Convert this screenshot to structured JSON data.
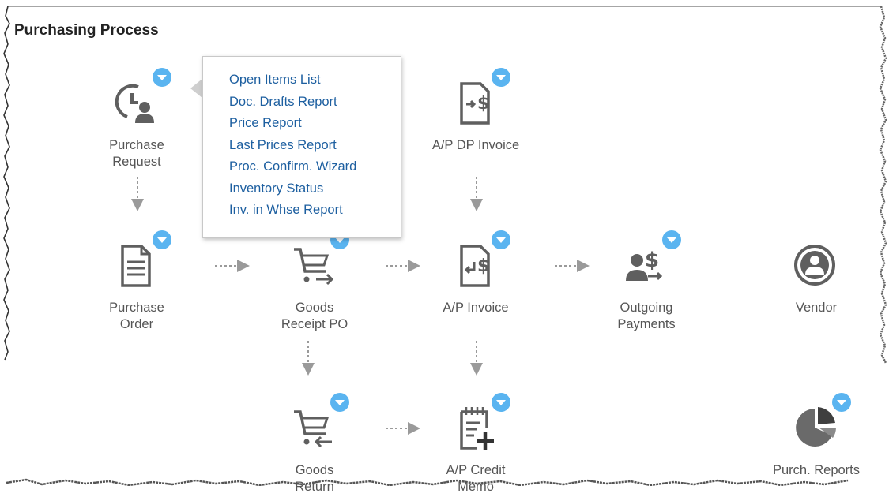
{
  "page": {
    "title": "Purchasing Process"
  },
  "colors": {
    "icon": "#5f5f5f",
    "caret": "#5ab4f0",
    "link": "#1d5fa0",
    "focus": "#e7a43a",
    "arrow": "#9a9a9a"
  },
  "nodes": {
    "purchase_request": {
      "label_line1": "Purchase",
      "label_line2": "Request",
      "icon": "clock-person-icon"
    },
    "ap_dp_invoice": {
      "label_line1": "A/P DP Invoice",
      "label_line2": "",
      "icon": "document-dollar-icon"
    },
    "purchase_order": {
      "label_line1": "Purchase",
      "label_line2": "Order",
      "icon": "document-icon"
    },
    "goods_receipt_po": {
      "label_line1": "Goods",
      "label_line2": "Receipt PO",
      "icon": "cart-arrow-right-icon"
    },
    "ap_invoice": {
      "label_line1": "A/P Invoice",
      "label_line2": "",
      "icon": "document-dollar-return-icon"
    },
    "outgoing_payments": {
      "label_line1": "Outgoing",
      "label_line2": "Payments",
      "icon": "person-dollar-icon"
    },
    "vendor": {
      "label_line1": "Vendor",
      "label_line2": "",
      "icon": "person-circle-icon"
    },
    "goods_return": {
      "label_line1": "Goods",
      "label_line2": "Return",
      "icon": "cart-arrow-left-icon"
    },
    "ap_credit_memo": {
      "label_line1": "A/P Credit",
      "label_line2": "Memo",
      "icon": "calendar-plus-icon"
    },
    "purch_reports": {
      "label_line1": "Purch. Reports",
      "label_line2": "",
      "icon": "pie-chart-icon"
    }
  },
  "popup": {
    "items": [
      "Open Items List",
      "Doc. Drafts Report",
      "Price Report",
      "Last Prices Report",
      "Proc. Confirm. Wizard",
      "Inventory Status",
      "Inv. in Whse Report"
    ]
  }
}
